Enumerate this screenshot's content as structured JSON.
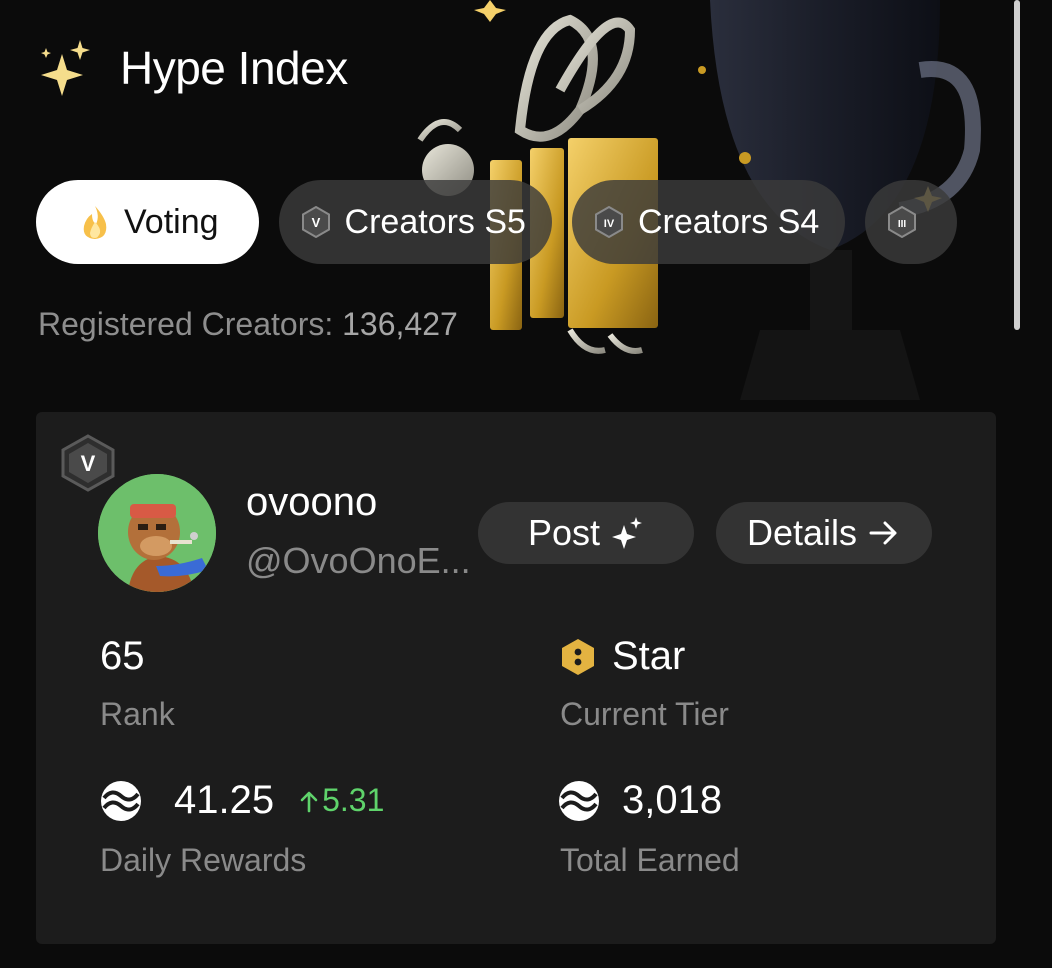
{
  "header": {
    "title": "Hype Index"
  },
  "tabs": [
    {
      "label": "Voting",
      "icon": "flame-icon",
      "active": true
    },
    {
      "label": "Creators S5",
      "badge": "V",
      "active": false
    },
    {
      "label": "Creators S4",
      "badge": "IV",
      "active": false
    },
    {
      "label": "",
      "badge": "III",
      "active": false
    }
  ],
  "registered": {
    "label": "Registered Creators:",
    "count": "136,427"
  },
  "creator": {
    "season_badge": "V",
    "name": "ovoono",
    "handle": "@OvoOnoE...",
    "post_label": "Post",
    "details_label": "Details",
    "stats": {
      "rank_value": "65",
      "rank_label": "Rank",
      "tier_value": "Star",
      "tier_label": "Current Tier",
      "daily_value": "41.25",
      "daily_delta": "5.31",
      "daily_label": "Daily Rewards",
      "total_value": "3,018",
      "total_label": "Total Earned"
    }
  },
  "colors": {
    "accent_gold": "#e3b341",
    "delta_green": "#5fd36b",
    "card_bg": "#1c1c1c"
  }
}
